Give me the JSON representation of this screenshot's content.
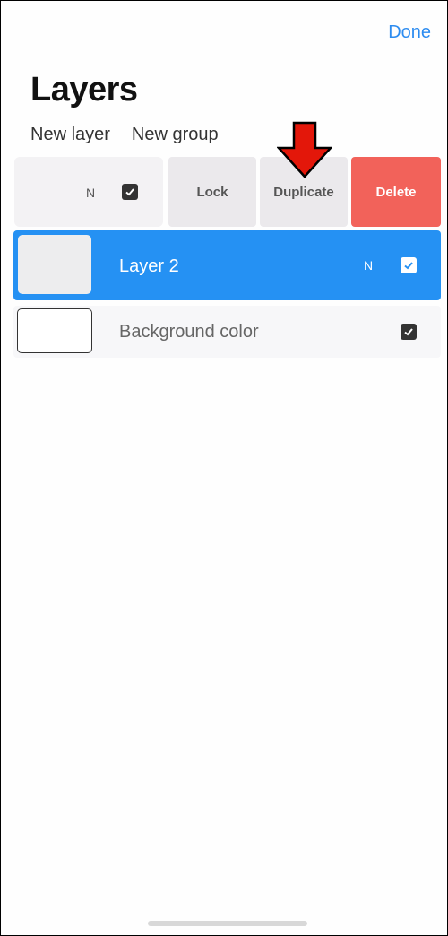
{
  "header": {
    "done_label": "Done",
    "title": "Layers"
  },
  "actions": {
    "new_layer": "New layer",
    "new_group": "New group"
  },
  "swiped_row": {
    "blend_mode": "N",
    "visible": true,
    "buttons": {
      "lock": "Lock",
      "duplicate": "Duplicate",
      "delete": "Delete"
    }
  },
  "layers": [
    {
      "name": "Layer 2",
      "blend_mode": "N",
      "visible": true,
      "selected": true
    },
    {
      "name": "Background color",
      "visible": true,
      "selected": false
    }
  ],
  "colors": {
    "accent": "#2591f3",
    "delete": "#f2625a",
    "link": "#2d8cf0",
    "annotation_arrow": "#e3170a"
  }
}
